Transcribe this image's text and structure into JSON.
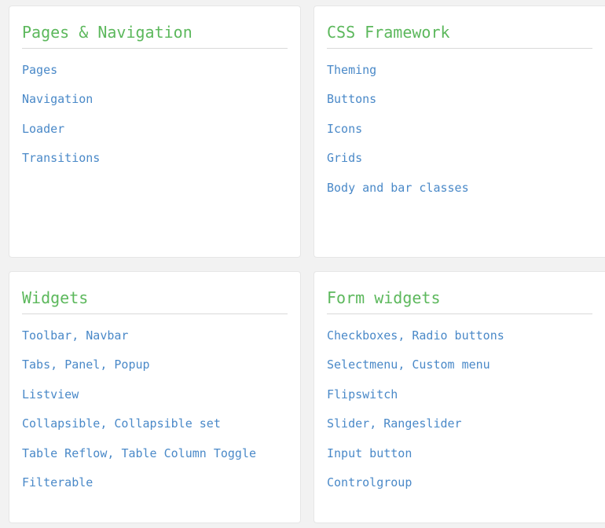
{
  "cards": [
    {
      "title": "Pages & Navigation",
      "items": [
        {
          "links": [
            "Pages"
          ]
        },
        {
          "links": [
            "Navigation"
          ]
        },
        {
          "links": [
            "Loader"
          ]
        },
        {
          "links": [
            "Transitions"
          ]
        }
      ]
    },
    {
      "title": "CSS Framework",
      "items": [
        {
          "links": [
            "Theming"
          ]
        },
        {
          "links": [
            "Buttons"
          ]
        },
        {
          "links": [
            "Icons"
          ]
        },
        {
          "links": [
            "Grids"
          ]
        },
        {
          "links": [
            "Body and bar classes"
          ]
        }
      ]
    },
    {
      "title": "Widgets",
      "items": [
        {
          "links": [
            "Toolbar",
            "Navbar"
          ]
        },
        {
          "links": [
            "Tabs",
            "Panel",
            "Popup"
          ]
        },
        {
          "links": [
            "Listview"
          ]
        },
        {
          "links": [
            "Collapsible",
            "Collapsible set"
          ]
        },
        {
          "links": [
            "Table Reflow",
            "Table Column Toggle"
          ]
        },
        {
          "links": [
            "Filterable"
          ]
        }
      ]
    },
    {
      "title": "Form widgets",
      "items": [
        {
          "links": [
            "Checkboxes",
            "Radio buttons"
          ]
        },
        {
          "links": [
            "Selectmenu",
            "Custom menu"
          ]
        },
        {
          "links": [
            "Flipswitch"
          ]
        },
        {
          "links": [
            "Slider",
            "Rangeslider"
          ]
        },
        {
          "links": [
            "Input button"
          ]
        },
        {
          "links": [
            "Controlgroup"
          ]
        }
      ]
    }
  ],
  "separator": ",",
  "colors": {
    "title": "#5cb85c",
    "link": "#4a89c8",
    "card_background": "#ffffff",
    "page_background": "#f2f2f2"
  }
}
